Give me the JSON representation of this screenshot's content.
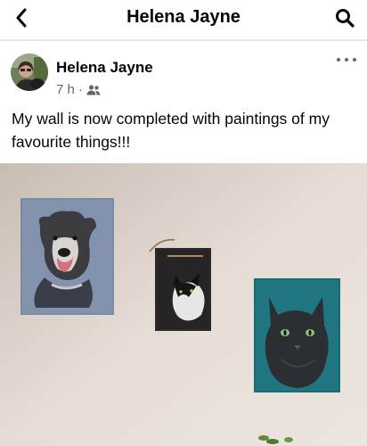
{
  "header": {
    "title": "Helena Jayne"
  },
  "post": {
    "author": "Helena Jayne",
    "time": "7 h",
    "separator": "·",
    "audience_icon": "friends-icon",
    "text": "My wall is now completed with paintings of my favourite things!!!"
  },
  "icons": {
    "back": "chevron-left-icon",
    "search": "search-icon",
    "more": "more-horizontal-icon"
  },
  "colors": {
    "text_primary": "#050505",
    "text_secondary": "#65676b",
    "divider": "#e4e6eb"
  }
}
